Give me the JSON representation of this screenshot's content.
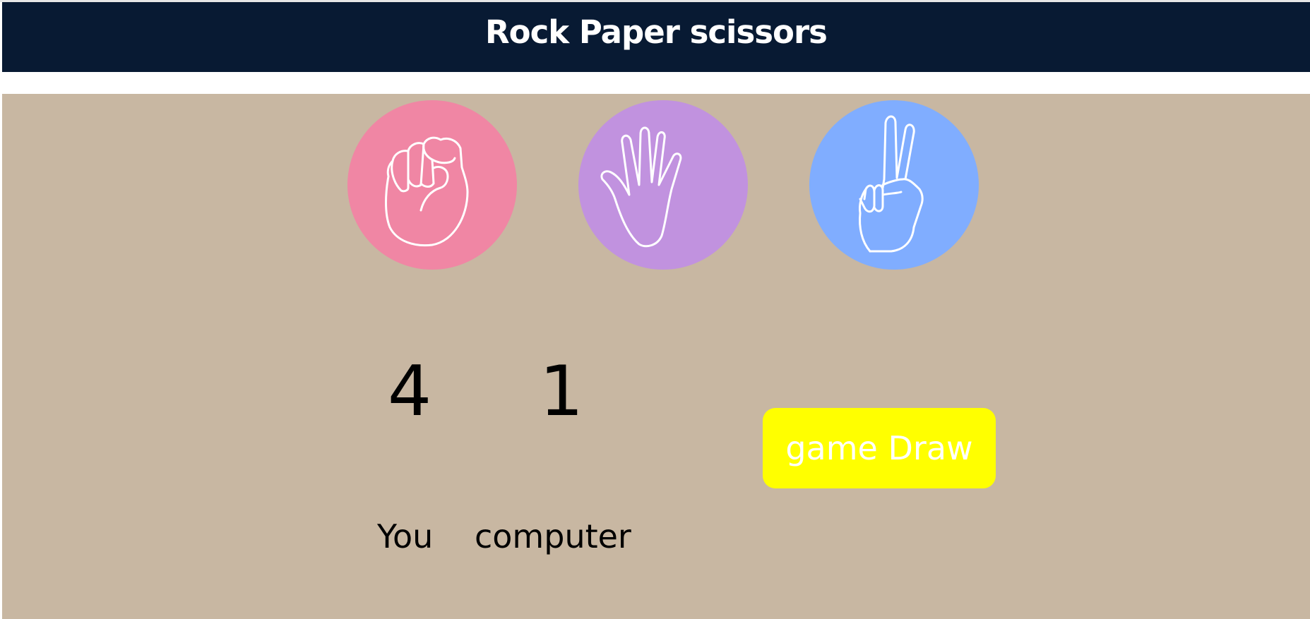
{
  "header": {
    "title": "Rock Paper scissors"
  },
  "choices": [
    {
      "id": "rock",
      "icon": "rock-fist-icon",
      "color": "#f086a4"
    },
    {
      "id": "paper",
      "icon": "paper-hand-icon",
      "color": "#c192df"
    },
    {
      "id": "scissors",
      "icon": "scissors-hand-icon",
      "color": "#80adff"
    }
  ],
  "scoreboard": {
    "user_score": "4",
    "computer_score": "1",
    "user_label": "You",
    "computer_label": "computer"
  },
  "message": {
    "text": "game Draw",
    "color": "#ffff00"
  },
  "colors": {
    "header_bg": "#081a33",
    "main_bg": "#c8b7a2"
  }
}
